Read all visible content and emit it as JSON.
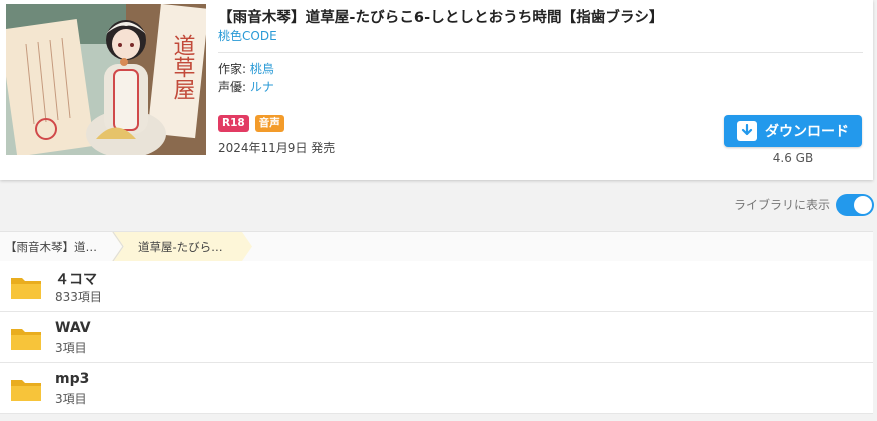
{
  "product": {
    "title": "【雨音木琴】道草屋-たびらこ6-しとしとおうち時間【指歯ブラシ】",
    "circle": "桃色CODE",
    "author_label": "作家:",
    "author": "桃鳥",
    "voice_label": "声優:",
    "voice": "ルナ",
    "badges": [
      "R18",
      "音声"
    ],
    "release_date": "2024年11月9日 発売",
    "download_label": "ダウンロード",
    "file_size": "4.6 GB",
    "cover_icon": "cover-image",
    "cover_sign_text": "道草屋"
  },
  "library": {
    "toggle_label": "ライブラリに表示",
    "toggle_on": true
  },
  "breadcrumb": [
    "【雨音木琴】道…",
    "道草屋-たびら…"
  ],
  "folders": [
    {
      "name": "４コマ",
      "count": "833項目"
    },
    {
      "name": "WAV",
      "count": "3項目"
    },
    {
      "name": "mp3",
      "count": "3項目"
    }
  ],
  "colors": {
    "accent": "#2399ec",
    "link": "#2a9ad6",
    "r18": "#e23b63",
    "voice": "#f39b2a",
    "folder": "#f7c43a"
  }
}
